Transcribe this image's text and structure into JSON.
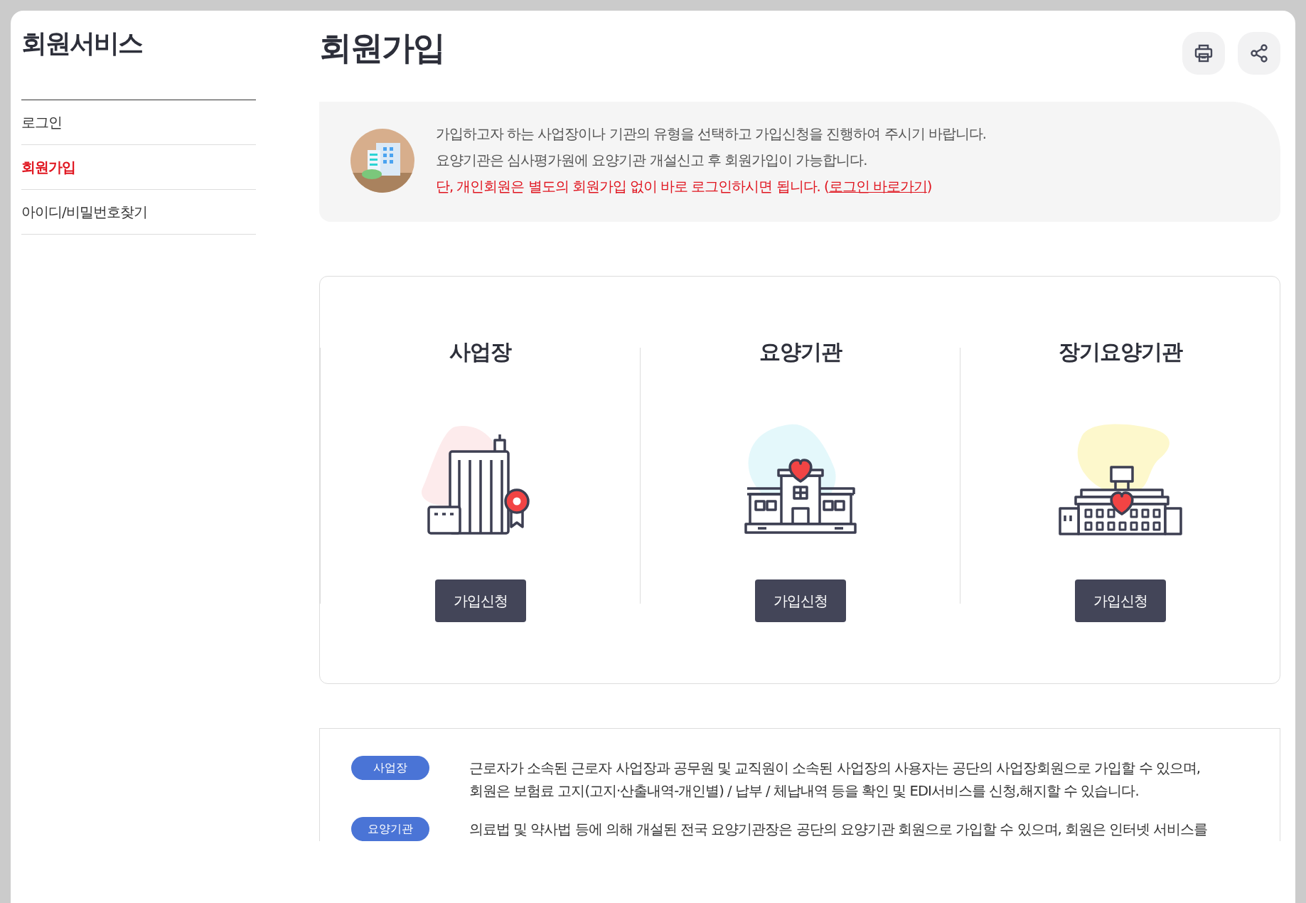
{
  "sidebar": {
    "title": "회원서비스",
    "items": [
      {
        "label": "로그인",
        "selected": false
      },
      {
        "label": "회원가입",
        "selected": true
      },
      {
        "label": "아이디/비밀번호찾기",
        "selected": false
      }
    ]
  },
  "page": {
    "title": "회원가입"
  },
  "notice": {
    "lines": [
      {
        "kind": "normal",
        "text": "가입하고자 하는 사업장이나 기관의 유형을 선택하고 가입신청을 진행하여 주시기 바랍니다."
      },
      {
        "kind": "normal",
        "text": "요양기관은 심사평가원에 요양기관 개설신고 후 회원가입이 가능합니다."
      },
      {
        "kind": "warning",
        "text": "단, 개인회원은 별도의 회원가입 없이 바로 로그인하시면 됩니다. (",
        "link": "로그인 바로가기",
        "after": ")"
      }
    ]
  },
  "cards": [
    {
      "kind": "office",
      "title": "사업장",
      "button": "가입신청"
    },
    {
      "kind": "hospital",
      "title": "요양기관",
      "button": "가입신청"
    },
    {
      "kind": "care",
      "title": "장기요양기관",
      "button": "가입신청"
    }
  ],
  "descriptions": [
    {
      "badge": "사업장",
      "lines": [
        "근로자가 소속된 근로자 사업장과 공무원 및 교직원이 소속된 사업장의 사용자는 공단의 사업장회원으로 가입할 수 있으며,",
        "회원은 보험료 고지(고지·산출내역-개인별) / 납부 / 체납내역 등을 확인 및 EDI서비스를 신청,해지할 수 있습니다."
      ]
    },
    {
      "badge": "요양기관",
      "lines": [
        "의료법 및 약사법 등에 의해 개설된 전국 요양기관장은 공단의 요양기관 회원으로 가입할 수 있으며, 회원은 인터넷 서비스를"
      ]
    }
  ]
}
